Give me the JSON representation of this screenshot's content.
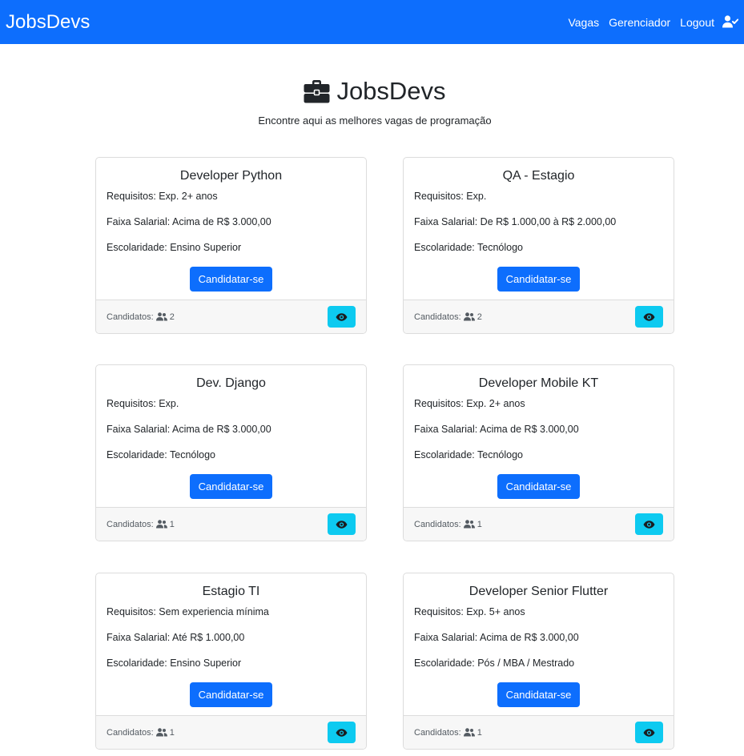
{
  "navbar": {
    "brand": "JobsDevs",
    "links": [
      "Vagas",
      "Gerenciador",
      "Logout"
    ],
    "user_icon": "user-check-icon"
  },
  "hero": {
    "title": "JobsDevs",
    "title_icon": "briefcase-icon",
    "subtitle": "Encontre aqui as melhores vagas de programação"
  },
  "jobs": [
    {
      "title": "Developer Python",
      "requisitos": "Requisitos: Exp. 2+ anos",
      "faixa": "Faixa Salarial: Acima de R$ 3.000,00",
      "escolaridade": "Escolaridade: Ensino Superior",
      "apply_label": "Candidatar-se",
      "candidatos_label": "Candidatos:",
      "candidatos_count": "2"
    },
    {
      "title": "QA - Estagio",
      "requisitos": "Requisitos: Exp.",
      "faixa": "Faixa Salarial: De R$ 1.000,00 à R$ 2.000,00",
      "escolaridade": "Escolaridade: Tecnólogo",
      "apply_label": "Candidatar-se",
      "candidatos_label": "Candidatos:",
      "candidatos_count": "2"
    },
    {
      "title": "Dev. Django",
      "requisitos": "Requisitos: Exp.",
      "faixa": "Faixa Salarial: Acima de R$ 3.000,00",
      "escolaridade": "Escolaridade: Tecnólogo",
      "apply_label": "Candidatar-se",
      "candidatos_label": "Candidatos:",
      "candidatos_count": "1"
    },
    {
      "title": "Developer Mobile KT",
      "requisitos": "Requisitos: Exp. 2+ anos",
      "faixa": "Faixa Salarial: Acima de R$ 3.000,00",
      "escolaridade": "Escolaridade: Tecnólogo",
      "apply_label": "Candidatar-se",
      "candidatos_label": "Candidatos:",
      "candidatos_count": "1"
    },
    {
      "title": "Estagio TI",
      "requisitos": "Requisitos: Sem experiencia mínima",
      "faixa": "Faixa Salarial: Até R$ 1.000,00",
      "escolaridade": "Escolaridade: Ensino Superior",
      "apply_label": "Candidatar-se",
      "candidatos_label": "Candidatos:",
      "candidatos_count": "1"
    },
    {
      "title": "Developer Senior Flutter",
      "requisitos": "Requisitos: Exp. 5+ anos",
      "faixa": "Faixa Salarial: Acima de R$ 3.000,00",
      "escolaridade": "Escolaridade: Pós / MBA / Mestrado",
      "apply_label": "Candidatar-se",
      "candidatos_label": "Candidatos:",
      "candidatos_count": "1"
    }
  ],
  "colors": {
    "primary": "#0d6efd",
    "info": "#0dcaf0",
    "footer_bg": "#f7f7f7",
    "border": "#dcdcdc"
  },
  "icons": {
    "candidates": "users-icon",
    "view": "eye-icon"
  }
}
